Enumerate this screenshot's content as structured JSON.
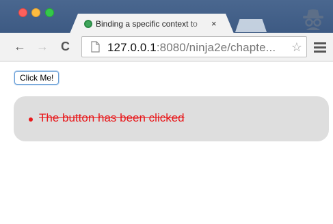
{
  "browser": {
    "tab": {
      "title": "Binding a specific context to",
      "close_glyph": "×",
      "favicon": "green-circle-icon"
    },
    "toolbar": {
      "back_glyph": "←",
      "forward_glyph": "→",
      "reload_glyph": "C",
      "url_host": "127.0.0.1",
      "url_rest": ":8080/ninja2e/chapte...",
      "star_glyph": "☆"
    },
    "colors": {
      "titlebar": "#3f5c85",
      "tab": "#f2f2f2",
      "close": "#fc605c",
      "minimize": "#fdbc40",
      "maximize": "#34c84a"
    }
  },
  "page": {
    "button_label": "Click Me!",
    "results": [
      {
        "text": "The button has been clicked"
      }
    ],
    "colors": {
      "result_text": "#e8191c",
      "result_box": "#dedede",
      "button_border": "#6a9fd6"
    }
  }
}
